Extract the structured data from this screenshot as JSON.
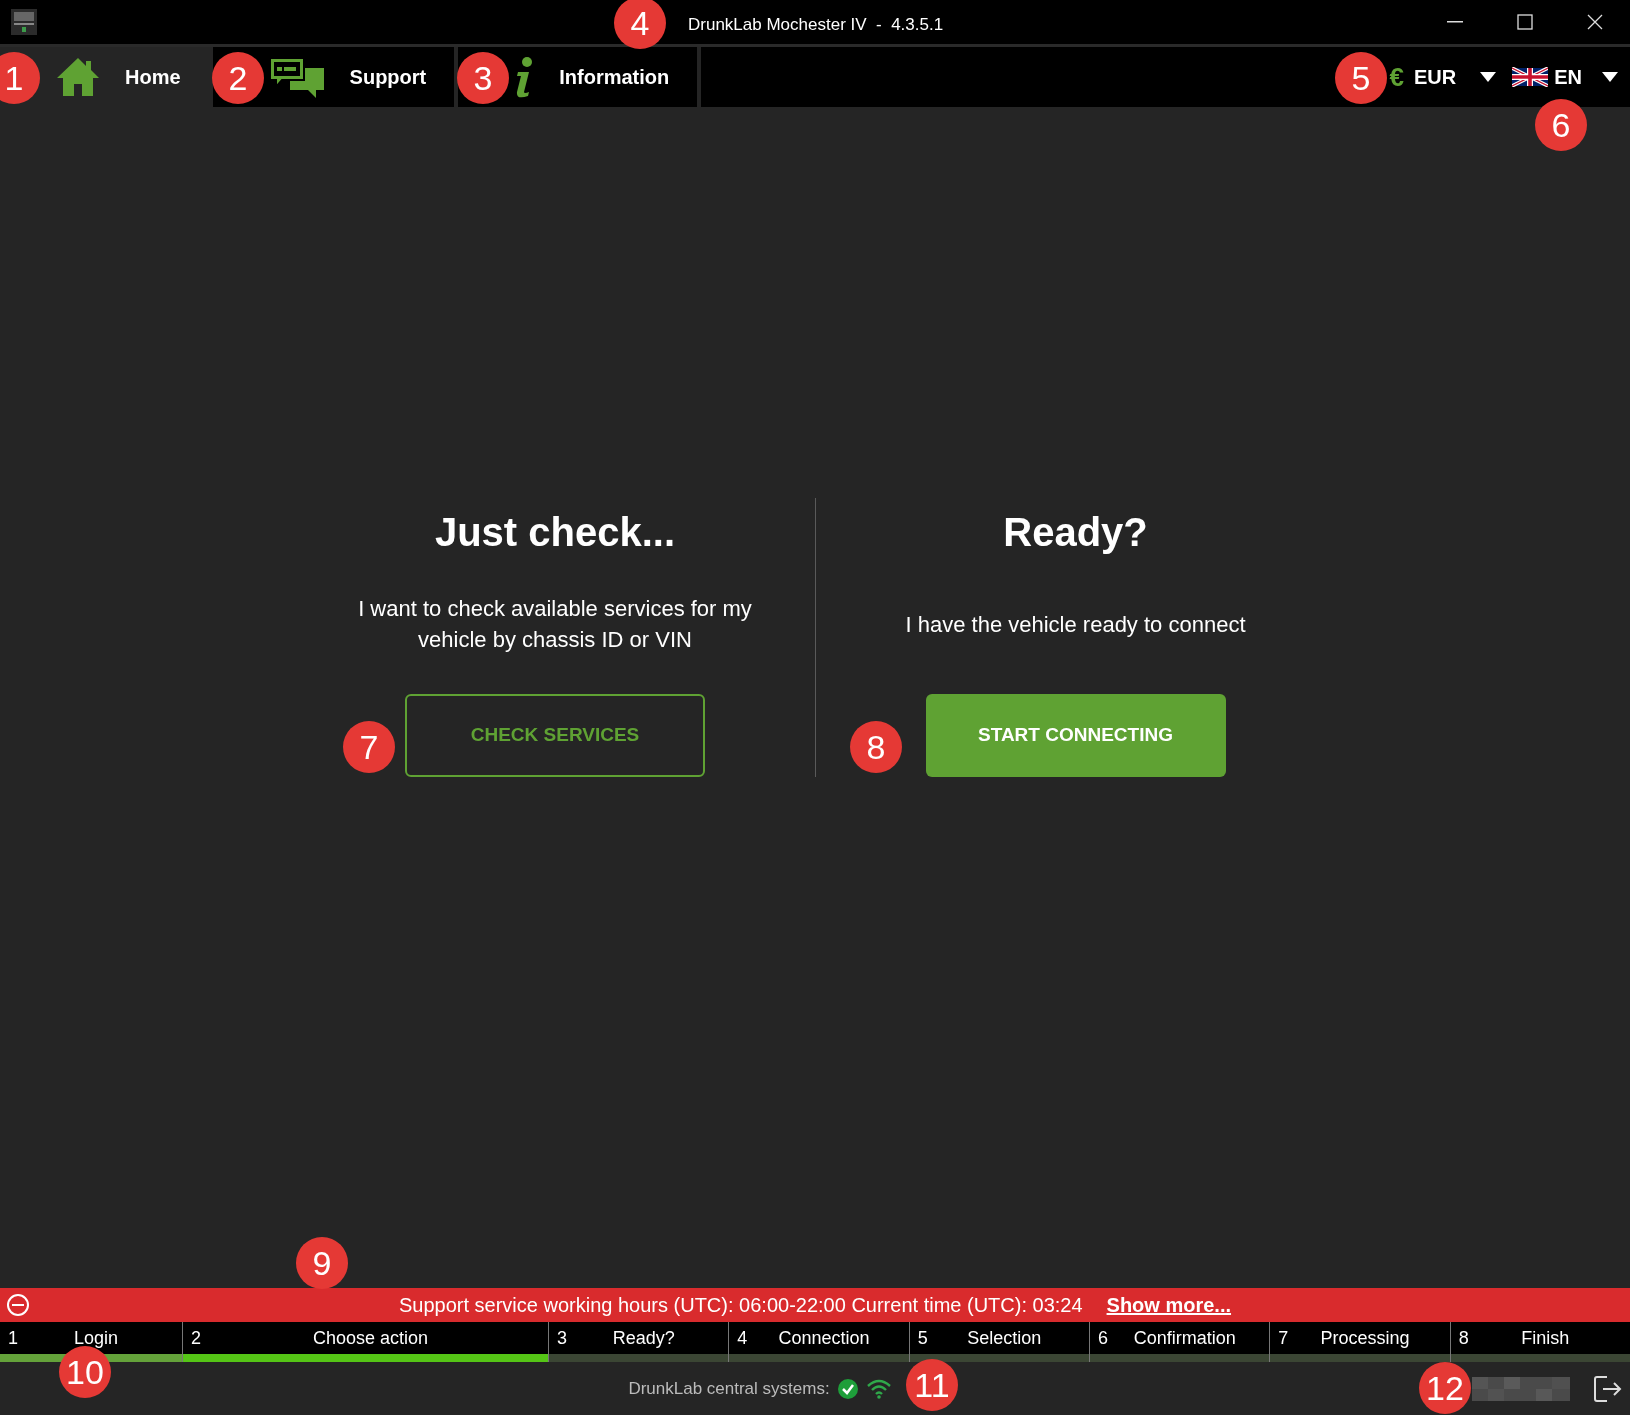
{
  "window": {
    "title": "DrunkLab Mochester IV  -  4.3.5.1"
  },
  "nav": [
    {
      "label": "Home",
      "selected": true
    },
    {
      "label": "Support",
      "selected": false
    },
    {
      "label": "Information",
      "selected": false
    }
  ],
  "currency": {
    "symbol": "€",
    "label": "EUR"
  },
  "language": {
    "label": "EN"
  },
  "options": [
    {
      "title": "Just check...",
      "text": "I want to check available services for my vehicle by chassis ID or VIN",
      "button": "CHECK SERVICES",
      "kind": "outline"
    },
    {
      "title": "Ready?",
      "text": "I have the vehicle ready to connect",
      "button": "START CONNECTING",
      "kind": "filled"
    }
  ],
  "notice": {
    "text": "Support service working hours (UTC): 06:00-22:00 Current time (UTC): 03:24",
    "link": "Show more..."
  },
  "steps": [
    {
      "number": "1",
      "label": "Login",
      "done": true,
      "selected": false
    },
    {
      "number": "2",
      "label": "Choose action",
      "done": false,
      "selected": true
    },
    {
      "number": "3",
      "label": "Ready?",
      "done": false,
      "selected": false
    },
    {
      "number": "4",
      "label": "Connection",
      "done": false,
      "selected": false
    },
    {
      "number": "5",
      "label": "Selection",
      "done": false,
      "selected": false
    },
    {
      "number": "6",
      "label": "Confirmation",
      "done": false,
      "selected": false
    },
    {
      "number": "7",
      "label": "Processing",
      "done": false,
      "selected": false
    },
    {
      "number": "8",
      "label": "Finish",
      "done": false,
      "selected": false
    }
  ],
  "status": {
    "label": "DrunkLab central systems:"
  },
  "callouts": [
    "1",
    "2",
    "3",
    "4",
    "5",
    "6",
    "7",
    "8",
    "9",
    "10",
    "11",
    "12"
  ]
}
